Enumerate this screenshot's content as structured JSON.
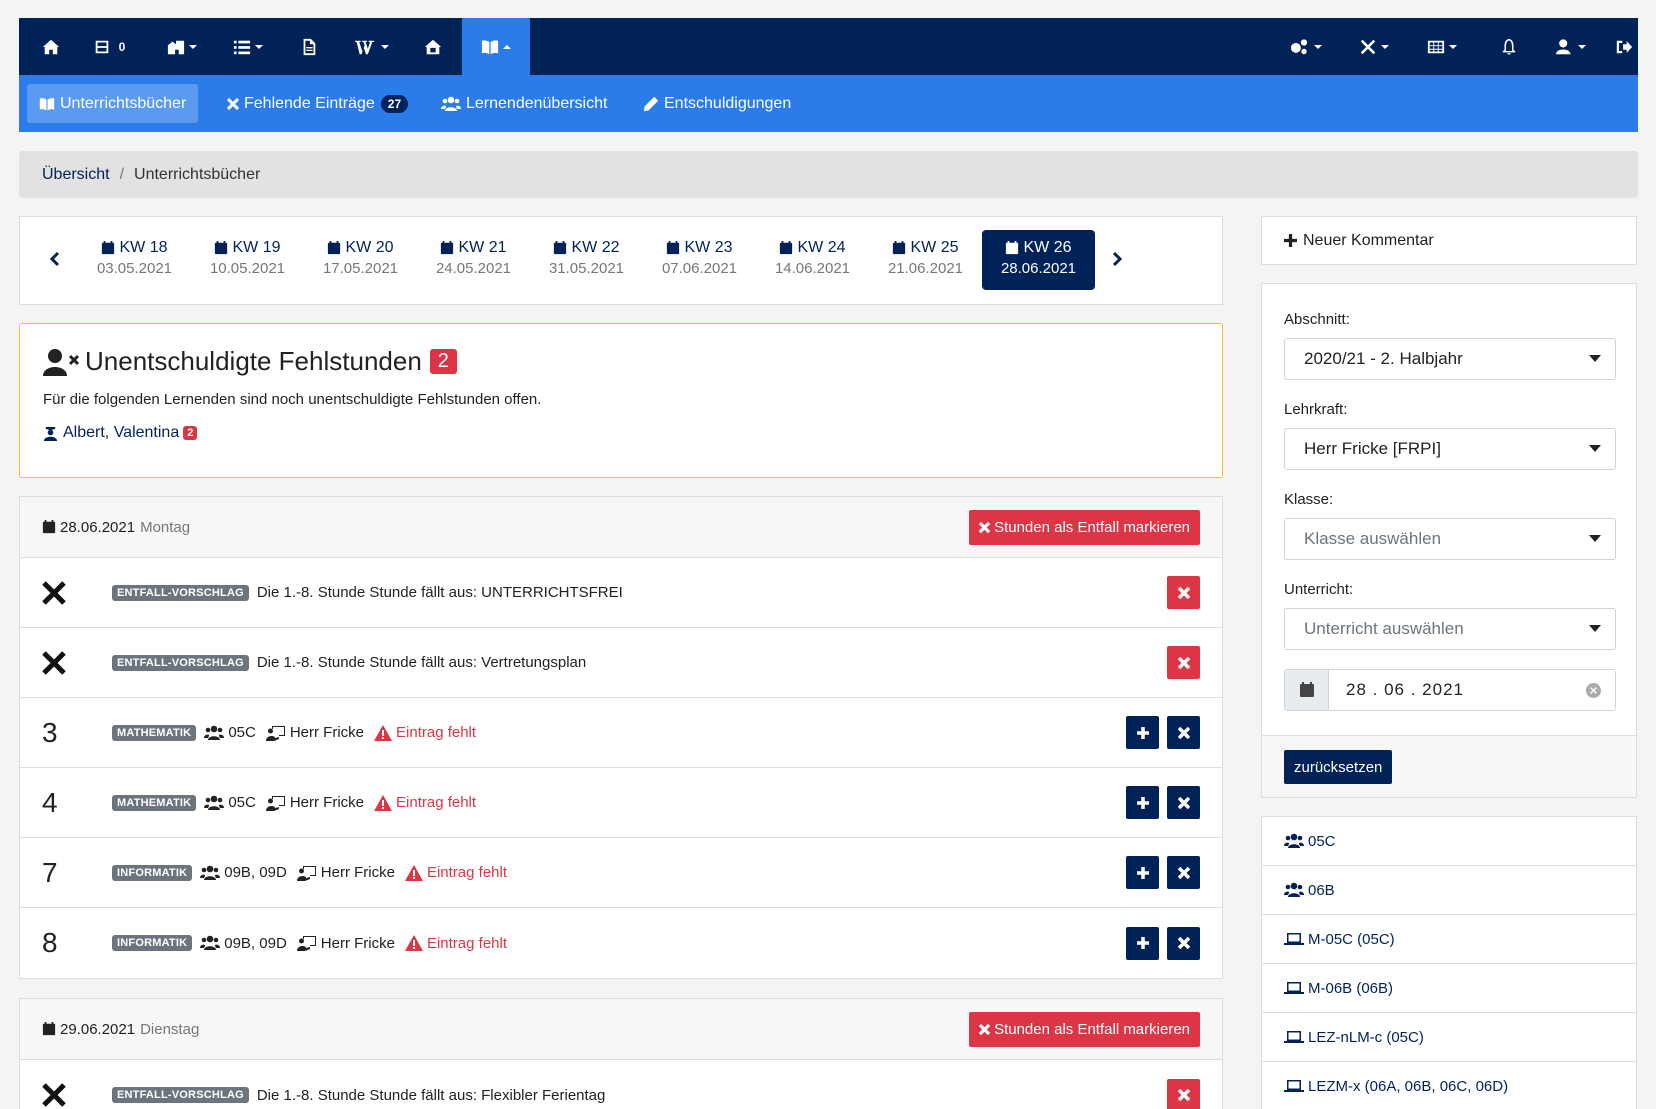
{
  "topnav": {
    "mail_count": "0",
    "icons": [
      "home-icon",
      "inbox-icon",
      "buildings-icon",
      "list-icon",
      "document-icon",
      "wiki-icon",
      "house-icon",
      "book-open-icon",
      "cogs-icon",
      "tools-icon",
      "grid-icon",
      "bell-icon",
      "user-icon",
      "logout-icon"
    ]
  },
  "subnav": {
    "items": [
      {
        "label": "Unterrichtsbücher",
        "icon": "book-open-icon"
      },
      {
        "label": "Fehlende Einträge",
        "icon": "times-icon",
        "badge": "27"
      },
      {
        "label": "Lernendenübersicht",
        "icon": "users-icon"
      },
      {
        "label": "Entschuldigungen",
        "icon": "pencil-icon"
      }
    ]
  },
  "breadcrumb": {
    "home": "Übersicht",
    "separator": "/",
    "current": "Unterrichtsbücher"
  },
  "weeks": [
    {
      "kw": "KW 18",
      "date": "03.05.2021"
    },
    {
      "kw": "KW 19",
      "date": "10.05.2021"
    },
    {
      "kw": "KW 20",
      "date": "17.05.2021"
    },
    {
      "kw": "KW 21",
      "date": "24.05.2021"
    },
    {
      "kw": "KW 22",
      "date": "31.05.2021"
    },
    {
      "kw": "KW 23",
      "date": "07.06.2021"
    },
    {
      "kw": "KW 24",
      "date": "14.06.2021"
    },
    {
      "kw": "KW 25",
      "date": "21.06.2021"
    },
    {
      "kw": "KW 26",
      "date": "28.06.2021"
    }
  ],
  "alert": {
    "title": "Unentschuldigte Fehlstunden",
    "count": "2",
    "text": "Für die folgenden Lernenden sind noch unentschuldigte Fehlstunden offen.",
    "student": "Albert, Valentina",
    "student_count": "2"
  },
  "day1": {
    "date": "28.06.2021",
    "weekday": "Montag",
    "button": "Stunden als Entfall markieren",
    "rows": [
      {
        "tag": "ENTFALL-VORSCHLAG",
        "text": "Die 1.-8. Stunde Stunde fällt aus: UNTERRICHTSFREI"
      },
      {
        "tag": "ENTFALL-VORSCHLAG",
        "text": "Die 1.-8. Stunde Stunde fällt aus: Vertretungsplan"
      },
      {
        "hour": "3",
        "tag": "MATHEMATIK",
        "group": "05C",
        "teacher": "Herr Fricke",
        "status": "Eintrag fehlt"
      },
      {
        "hour": "4",
        "tag": "MATHEMATIK",
        "group": "05C",
        "teacher": "Herr Fricke",
        "status": "Eintrag fehlt"
      },
      {
        "hour": "7",
        "tag": "INFORMATIK",
        "group": "09B, 09D",
        "teacher": "Herr Fricke",
        "status": "Eintrag fehlt"
      },
      {
        "hour": "8",
        "tag": "INFORMATIK",
        "group": "09B, 09D",
        "teacher": "Herr Fricke",
        "status": "Eintrag fehlt"
      }
    ]
  },
  "day2": {
    "date": "29.06.2021",
    "weekday": "Dienstag",
    "button": "Stunden als Entfall markieren",
    "rows": [
      {
        "tag": "ENTFALL-VORSCHLAG",
        "text": "Die 1.-8. Stunde Stunde fällt aus: Flexibler Ferientag"
      }
    ]
  },
  "sidebar": {
    "new_comment": "Neuer Kommentar",
    "abschnitt_label": "Abschnitt:",
    "abschnitt_value": "2020/21 - 2. Halbjahr",
    "lehrkraft_label": "Lehrkraft:",
    "lehrkraft_value": "Herr Fricke [FRPI]",
    "klasse_label": "Klasse:",
    "klasse_placeholder": "Klasse auswählen",
    "unterricht_label": "Unterricht:",
    "unterricht_placeholder": "Unterricht auswählen",
    "date_value": "28 . 06 . 2021",
    "reset": "zurücksetzen",
    "list": [
      {
        "icon": "users-icon",
        "label": "05C"
      },
      {
        "icon": "users-icon",
        "label": "06B"
      },
      {
        "icon": "laptop-icon",
        "label": "M-05C (05C)"
      },
      {
        "icon": "laptop-icon",
        "label": "M-06B (06B)"
      },
      {
        "icon": "laptop-icon",
        "label": "LEZ-nLM-c (05C)"
      },
      {
        "icon": "laptop-icon",
        "label": "LEZM-x (06A, 06B, 06C, 06D)"
      }
    ]
  },
  "colors": {
    "navy": "#012257",
    "blue": "#2b7ce9",
    "red": "#dc3545",
    "warning": "#f0c02d",
    "tag": "#6c757d"
  }
}
